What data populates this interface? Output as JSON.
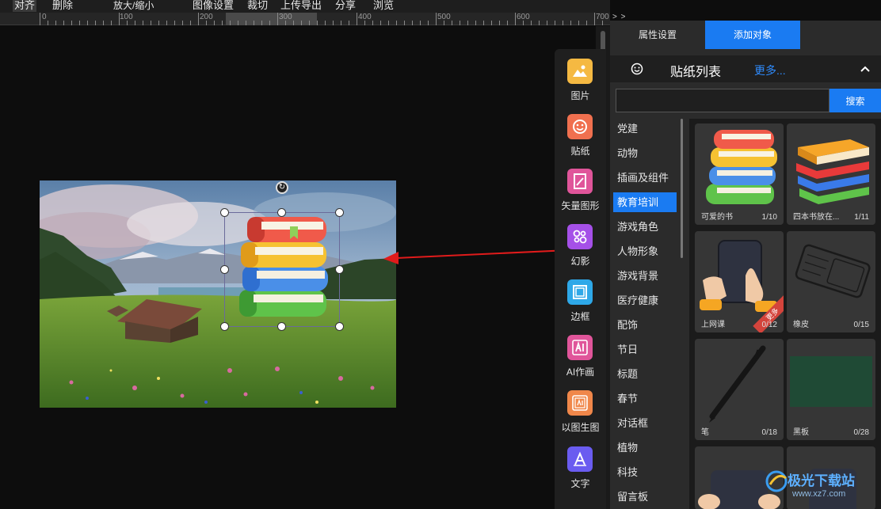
{
  "menu": {
    "align": "对齐",
    "delete": "删除",
    "zoom": "放大/缩小",
    "image_settings": "图像设置",
    "crop": "裁切",
    "upload_export": "上传导出",
    "share": "分享",
    "browse": "浏览"
  },
  "ruler": {
    "labels": [
      "0",
      "100",
      "200",
      "300",
      "400",
      "500",
      "600",
      "700"
    ],
    "overflow": "> >"
  },
  "tools": [
    {
      "label": "图片",
      "icon": "image-icon",
      "color": "#f5b942"
    },
    {
      "label": "贴纸",
      "icon": "sticker-icon",
      "color": "#f0704f"
    },
    {
      "label": "矢量图形",
      "icon": "vector-icon",
      "color": "#e0559a"
    },
    {
      "label": "幻影",
      "icon": "phantom-icon",
      "color": "#a550e8"
    },
    {
      "label": "边框",
      "icon": "frame-icon",
      "color": "#2ea8e8"
    },
    {
      "label": "AI作画",
      "icon": "ai-icon",
      "color": "#e0559a"
    },
    {
      "label": "以图生图",
      "icon": "img2img-icon",
      "color": "#f0874a"
    },
    {
      "label": "文字",
      "icon": "text-icon",
      "color": "#6a5cf0"
    }
  ],
  "panel": {
    "tab_properties": "属性设置",
    "tab_add_object": "添加对象",
    "sticker_title": "贴纸列表",
    "more": "更多...",
    "search_placeholder": "",
    "search_button": "搜索"
  },
  "categories": [
    "党建",
    "动物",
    "插画及组件",
    "教育培训",
    "游戏角色",
    "人物形象",
    "游戏背景",
    "医疗健康",
    "配饰",
    "节日",
    "标题",
    "春节",
    "对话框",
    "植物",
    "科技",
    "留言板"
  ],
  "active_category": "教育培训",
  "stickers": [
    {
      "name": "可爱的书",
      "count": "1/10"
    },
    {
      "name": "四本书放在...",
      "count": "1/11"
    },
    {
      "name": "上网课",
      "count": "0/12",
      "ribbon": "更多"
    },
    {
      "name": "橡皮",
      "count": "0/15"
    },
    {
      "name": "笔",
      "count": "0/18"
    },
    {
      "name": "黑板",
      "count": "0/28"
    }
  ],
  "watermark": {
    "text": "极光下载站",
    "url": "www.xz7.com"
  },
  "colors": {
    "accent": "#1a7bf2",
    "arrow": "#e01b1b",
    "background": "#0d0d0d"
  }
}
